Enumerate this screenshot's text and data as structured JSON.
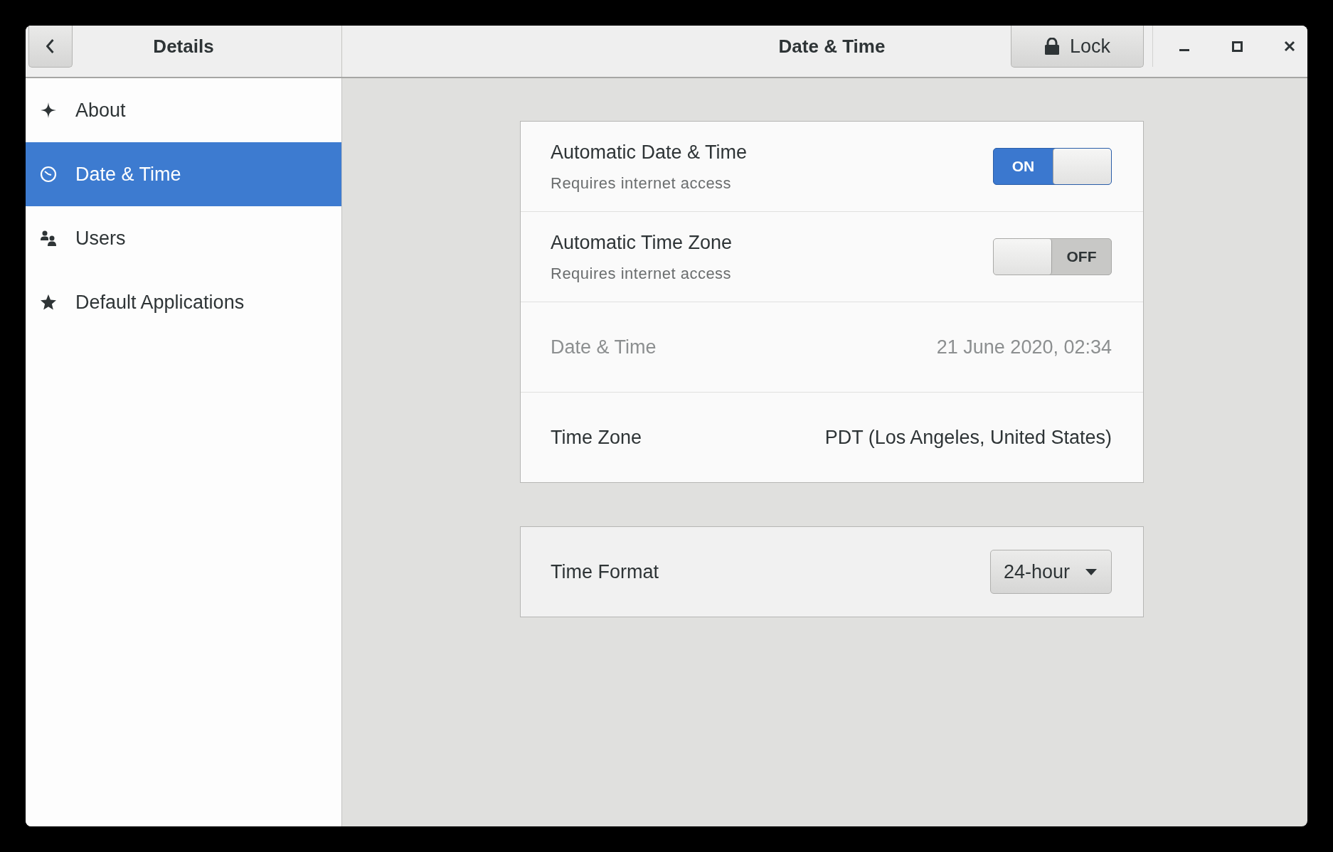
{
  "window": {
    "title": "Date & Time"
  },
  "headerbar": {
    "panel_title": "Details",
    "lock_button": {
      "label": "Lock"
    }
  },
  "sidebar": {
    "items": [
      {
        "label": "About",
        "selected": false
      },
      {
        "label": "Date & Time",
        "selected": true
      },
      {
        "label": "Users",
        "selected": false
      },
      {
        "label": "Default Applications",
        "selected": false
      }
    ]
  },
  "settings": {
    "rows": [
      {
        "kind": "switch",
        "label": "Automatic Date & Time",
        "sublabel": "Requires internet access",
        "on": true,
        "switch_text": "ON"
      },
      {
        "kind": "switch",
        "label": "Automatic Time Zone",
        "sublabel": "Requires internet access",
        "on": false,
        "switch_text": "OFF"
      },
      {
        "kind": "value",
        "label": "Date & Time",
        "value": "21 June 2020, 02:34",
        "disabled": true
      },
      {
        "kind": "value",
        "label": "Time Zone",
        "value": "PDT (Los Angeles, United States)",
        "disabled": false
      }
    ]
  },
  "format": {
    "label": "Time Format",
    "dropdown": {
      "value": "24-hour"
    }
  }
}
